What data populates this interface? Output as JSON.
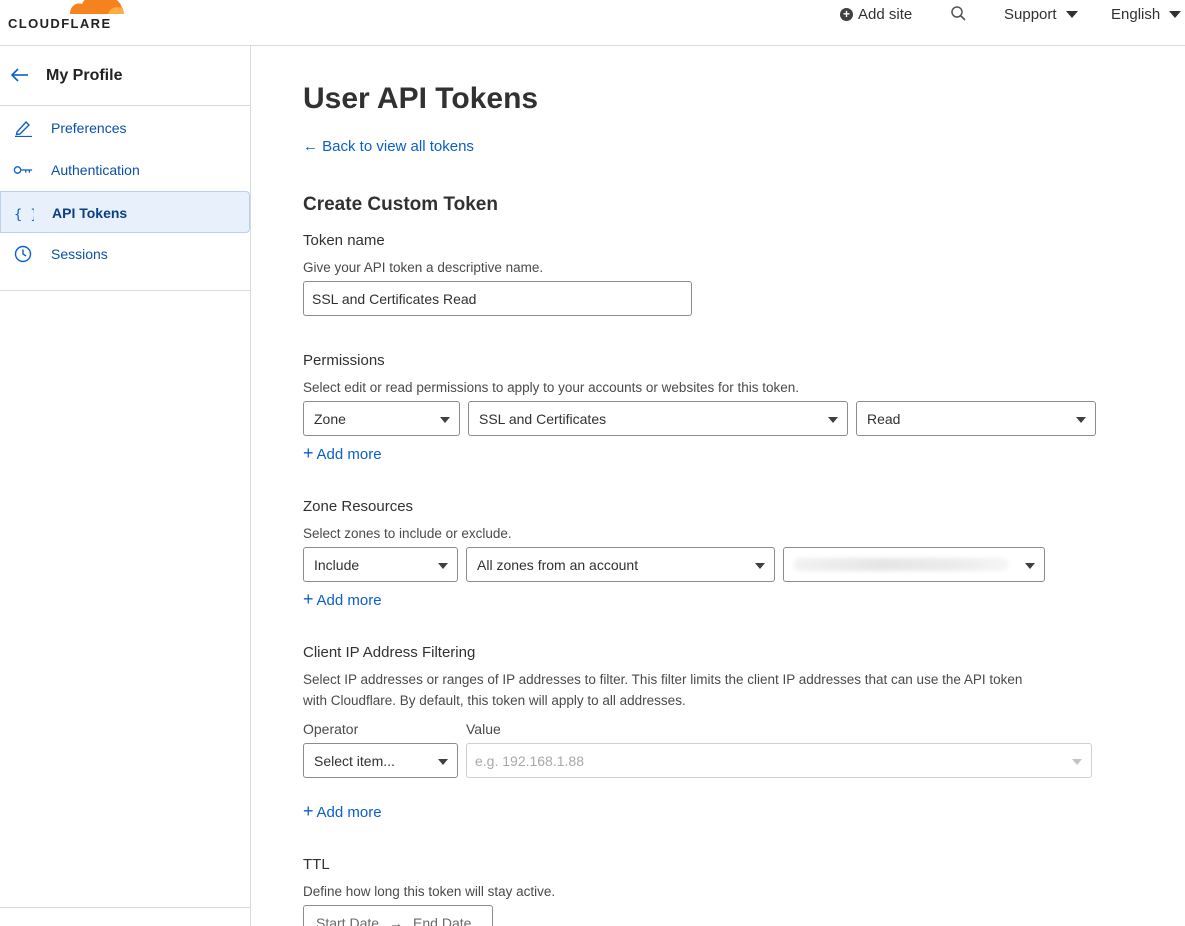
{
  "brand": {
    "name": "CLOUDFLARE",
    "logo_colors": [
      "#f6821f",
      "#fbad41"
    ]
  },
  "topbar": {
    "add_site": "Add site",
    "support": "Support",
    "language": "English"
  },
  "sidebar": {
    "title": "My Profile",
    "items": [
      {
        "label": "Preferences",
        "icon": "pencil-icon"
      },
      {
        "label": "Authentication",
        "icon": "key-icon"
      },
      {
        "label": "API Tokens",
        "icon": "braces-icon",
        "active": true
      },
      {
        "label": "Sessions",
        "icon": "clock-icon"
      }
    ]
  },
  "main": {
    "title": "User API Tokens",
    "back_link": "Back to view all tokens",
    "section_title": "Create Custom Token",
    "token_name": {
      "label": "Token name",
      "help": "Give your API token a descriptive name.",
      "value": "SSL and Certificates Read"
    },
    "permissions": {
      "label": "Permissions",
      "help": "Select edit or read permissions to apply to your accounts or websites for this token.",
      "scope": "Zone",
      "group": "SSL and Certificates",
      "level": "Read",
      "add_more": "Add more"
    },
    "zone_resources": {
      "label": "Zone Resources",
      "help": "Select zones to include or exclude.",
      "mode": "Include",
      "target": "All zones from an account",
      "add_more": "Add more"
    },
    "ip_filtering": {
      "label": "Client IP Address Filtering",
      "help_line1": "Select IP addresses or ranges of IP addresses to filter. This filter limits the client IP addresses that can use the API token",
      "help_line2": "with Cloudflare. By default, this token will apply to all addresses.",
      "operator_label": "Operator",
      "value_label": "Value",
      "operator_value": "Select item...",
      "value_placeholder": "e.g. 192.168.1.88",
      "add_more": "Add more"
    },
    "ttl": {
      "label": "TTL",
      "help": "Define how long this token will stay active.",
      "start": "Start Date",
      "end": "End Date"
    }
  },
  "colors": {
    "link": "#0b5fc9",
    "active_bg": "#e8f1fb",
    "brand_orange": "#f6821f"
  }
}
